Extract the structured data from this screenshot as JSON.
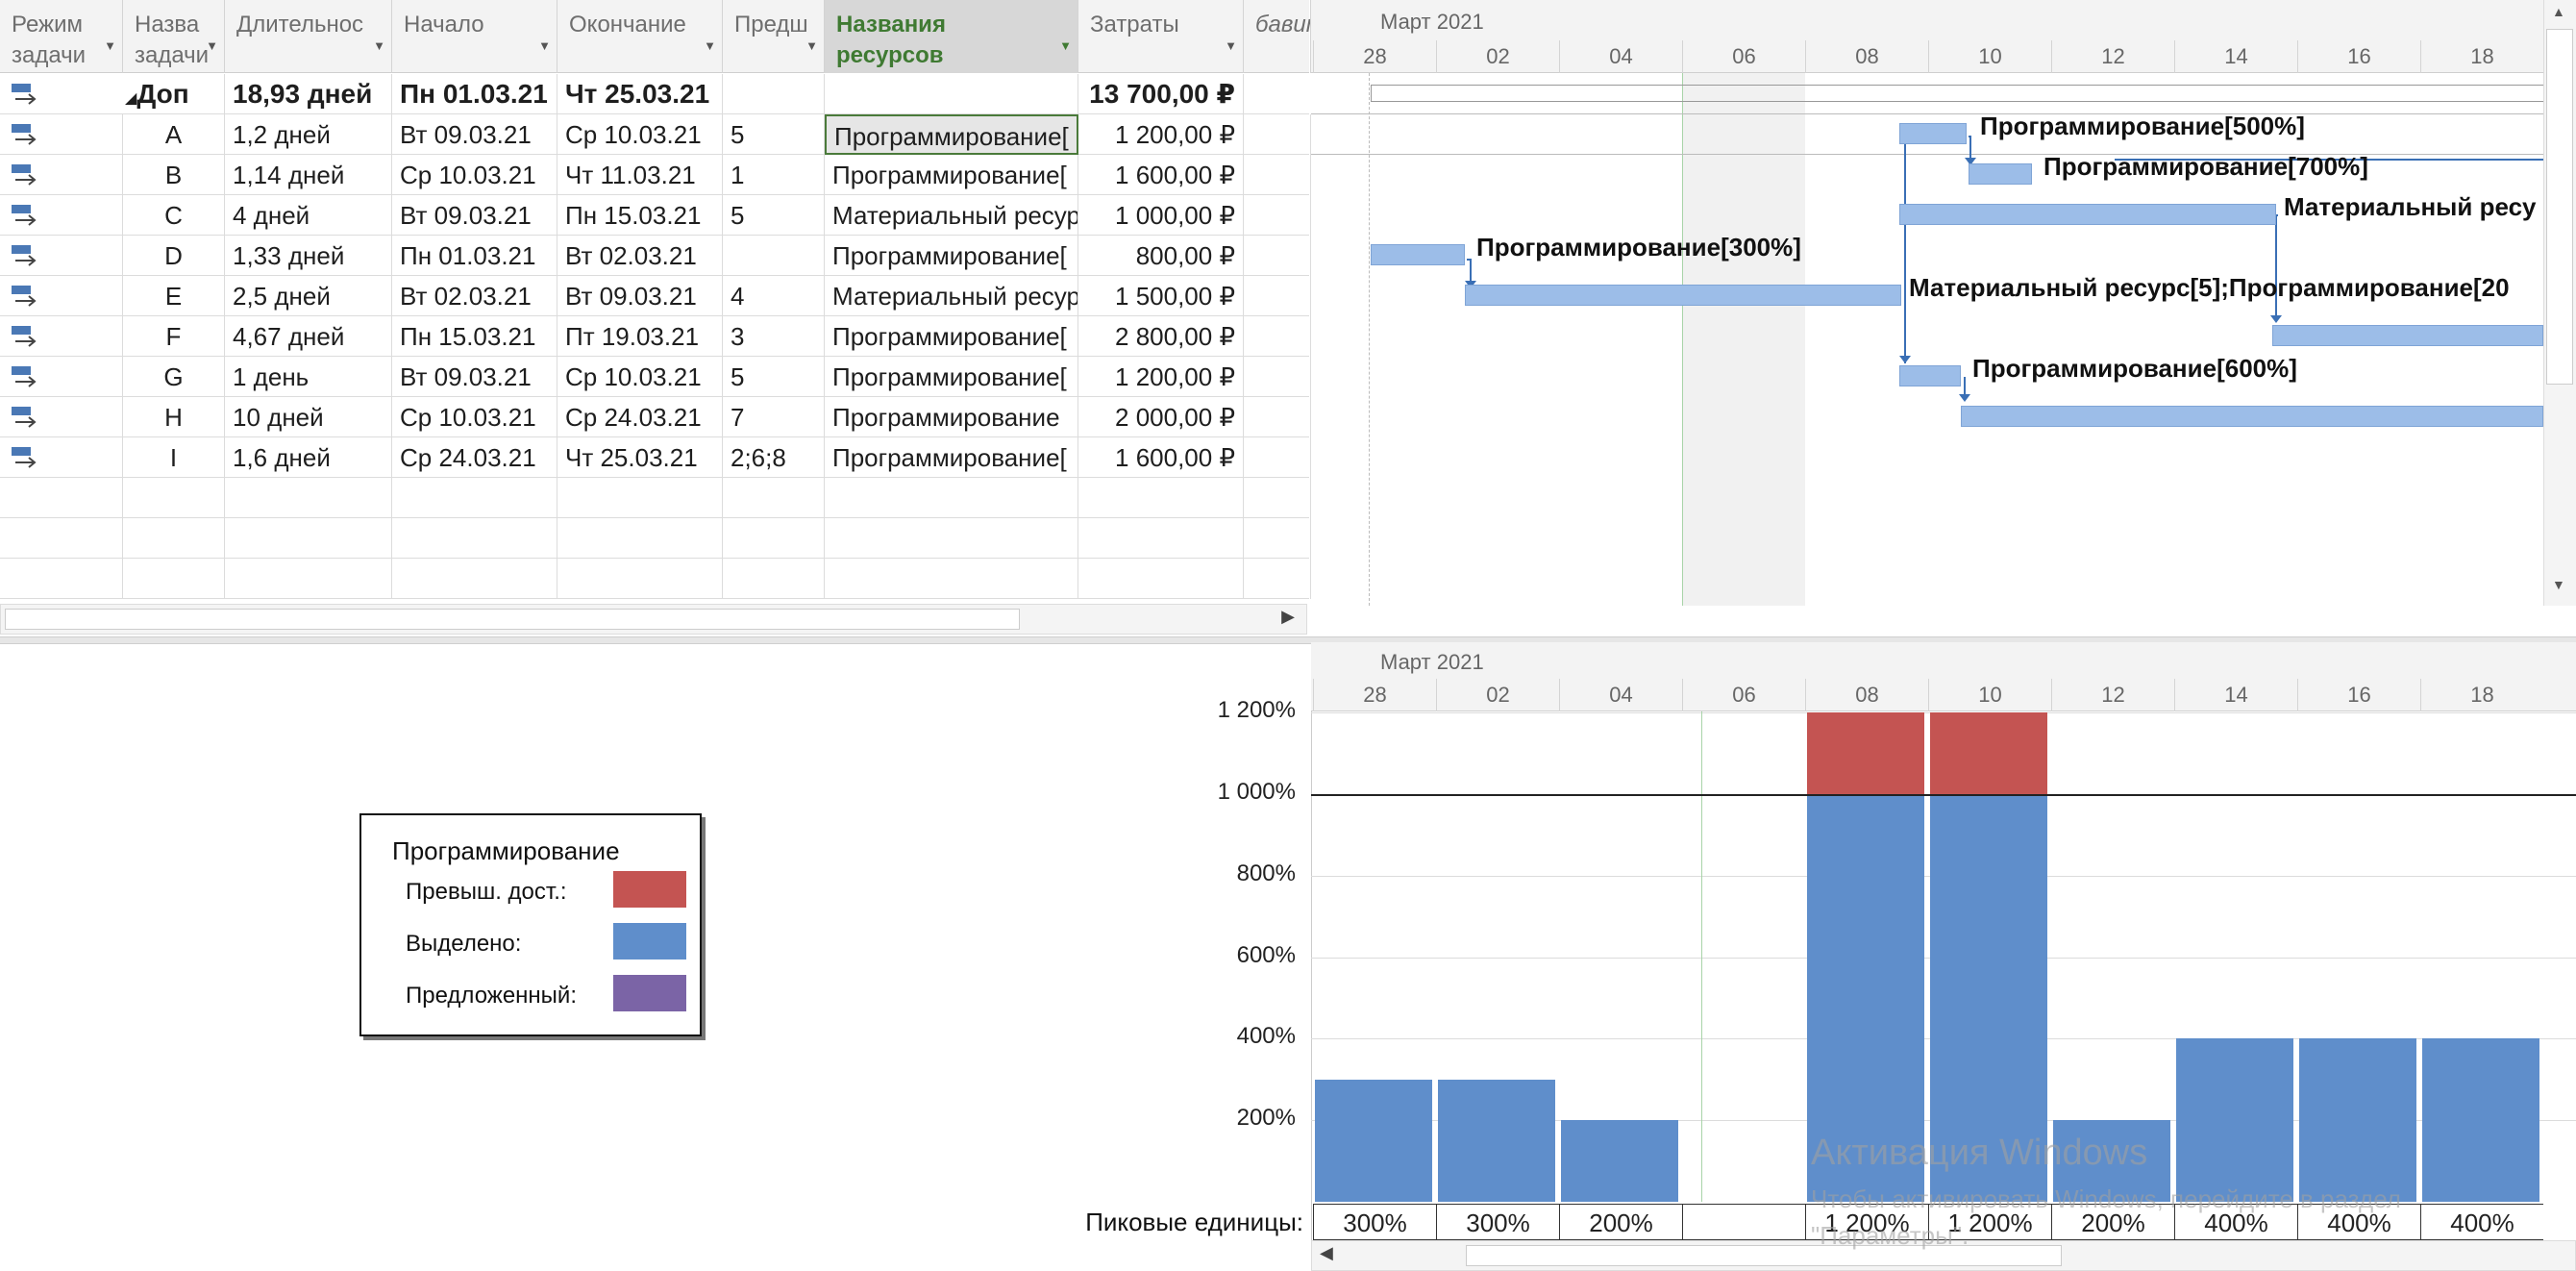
{
  "table": {
    "headers": [
      {
        "l1": "Режим",
        "l2": "задачи"
      },
      {
        "l1": "Назва",
        "l2": "задачи"
      },
      {
        "l1": "",
        "l2": "Длительнос"
      },
      {
        "l1": "",
        "l2": "Начало"
      },
      {
        "l1": "",
        "l2": "Окончание"
      },
      {
        "l1": "",
        "l2": "Предш"
      },
      {
        "l1": "Названия",
        "l2": "ресурсов"
      },
      {
        "l1": "",
        "l2": "Затраты"
      },
      {
        "l1": "",
        "l2": "бавит"
      }
    ],
    "summary": {
      "name": "Доп",
      "duration": "18,93 дней",
      "start": "Пн 01.03.21",
      "finish": "Чт 25.03.21",
      "cost": "13 700,00 ₽"
    },
    "rows": [
      {
        "name": "A",
        "duration": "1,2 дней",
        "start": "Вт 09.03.21",
        "finish": "Ср 10.03.21",
        "pred": "5",
        "resources": "Программирование[",
        "cost": "1 200,00 ₽"
      },
      {
        "name": "B",
        "duration": "1,14 дней",
        "start": "Ср 10.03.21",
        "finish": "Чт 11.03.21",
        "pred": "1",
        "resources": "Программирование[",
        "cost": "1 600,00 ₽"
      },
      {
        "name": "C",
        "duration": "4 дней",
        "start": "Вт 09.03.21",
        "finish": "Пн 15.03.21",
        "pred": "5",
        "resources": "Материальный ресур",
        "cost": "1 000,00 ₽"
      },
      {
        "name": "D",
        "duration": "1,33 дней",
        "start": "Пн 01.03.21",
        "finish": "Вт 02.03.21",
        "pred": "",
        "resources": "Программирование[",
        "cost": "800,00 ₽"
      },
      {
        "name": "E",
        "duration": "2,5 дней",
        "start": "Вт 02.03.21",
        "finish": "Вт 09.03.21",
        "pred": "4",
        "resources": "Материальный ресур",
        "cost": "1 500,00 ₽"
      },
      {
        "name": "F",
        "duration": "4,67 дней",
        "start": "Пн 15.03.21",
        "finish": "Пт 19.03.21",
        "pred": "3",
        "resources": "Программирование[",
        "cost": "2 800,00 ₽"
      },
      {
        "name": "G",
        "duration": "1 день",
        "start": "Вт 09.03.21",
        "finish": "Ср 10.03.21",
        "pred": "5",
        "resources": "Программирование[",
        "cost": "1 200,00 ₽"
      },
      {
        "name": "H",
        "duration": "10 дней",
        "start": "Ср 10.03.21",
        "finish": "Ср 24.03.21",
        "pred": "7",
        "resources": "Программирование",
        "cost": "2 000,00 ₽"
      },
      {
        "name": "I",
        "duration": "1,6 дней",
        "start": "Ср 24.03.21",
        "finish": "Чт 25.03.21",
        "pred": "2;6;8",
        "resources": "Программирование[",
        "cost": "1 600,00 ₽"
      }
    ]
  },
  "timeline": {
    "month": "Март 2021",
    "days": [
      "28",
      "02",
      "04",
      "06",
      "08",
      "10",
      "12",
      "14",
      "16",
      "18"
    ]
  },
  "gantt_labels": [
    "Программирование[500%]",
    "Программирование[700%]",
    "Материальный ресу",
    "Программирование[300%]",
    "Материальный ресурс[5];Программирование[20",
    "Программирование[600%]"
  ],
  "legend": {
    "title": "Программирование",
    "over_label": "Превыш. дост.:",
    "alloc_label": "Выделено:",
    "proposed_label": "Предложенный:",
    "colors": {
      "over": "#c45452",
      "alloc": "#5f8ecb",
      "proposed": "#7b64a6"
    }
  },
  "histogram": {
    "y_labels": [
      "1 200%",
      "1 000%",
      "800%",
      "600%",
      "400%",
      "200%"
    ],
    "peak_label": "Пиковые единицы:",
    "allocated": [
      300,
      300,
      200,
      0,
      1000,
      1000,
      200,
      400,
      400,
      400
    ],
    "overallocated": [
      0,
      0,
      0,
      0,
      200,
      200,
      0,
      0,
      0,
      0
    ],
    "peaks": [
      "300%",
      "300%",
      "200%",
      "",
      "1 200%",
      "1 200%",
      "200%",
      "400%",
      "400%",
      "400%"
    ]
  },
  "watermark": {
    "line1": "Активация Windows",
    "line2": "Чтобы активировать Windows, перейдите в раздел",
    "line3": "\"Параметры\"."
  }
}
